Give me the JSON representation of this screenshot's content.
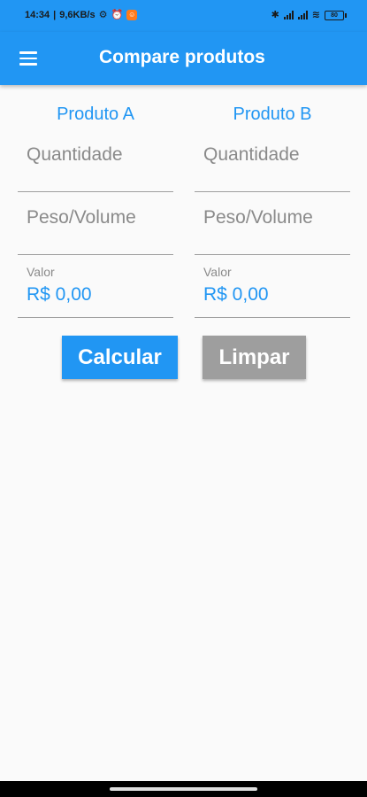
{
  "status_bar": {
    "time": "14:34",
    "net_speed": "9,6KB/s",
    "battery_level": "80"
  },
  "app_bar": {
    "title": "Compare produtos",
    "menu_icon": "hamburger-menu-icon",
    "color": "#2196f3"
  },
  "product_a": {
    "title": "Produto A",
    "quantity_placeholder": "Quantidade",
    "quantity_value": "",
    "weight_placeholder": "Peso/Volume",
    "weight_value": "",
    "value_label": "Valor",
    "value": "R$ 0,00"
  },
  "product_b": {
    "title": "Produto B",
    "quantity_placeholder": "Quantidade",
    "quantity_value": "",
    "weight_placeholder": "Peso/Volume",
    "weight_value": "",
    "value_label": "Valor",
    "value": "R$ 0,00"
  },
  "buttons": {
    "calculate_label": "Calcular",
    "clear_label": "Limpar",
    "calculate_color": "#2196f3",
    "clear_color": "#9e9e9e"
  }
}
